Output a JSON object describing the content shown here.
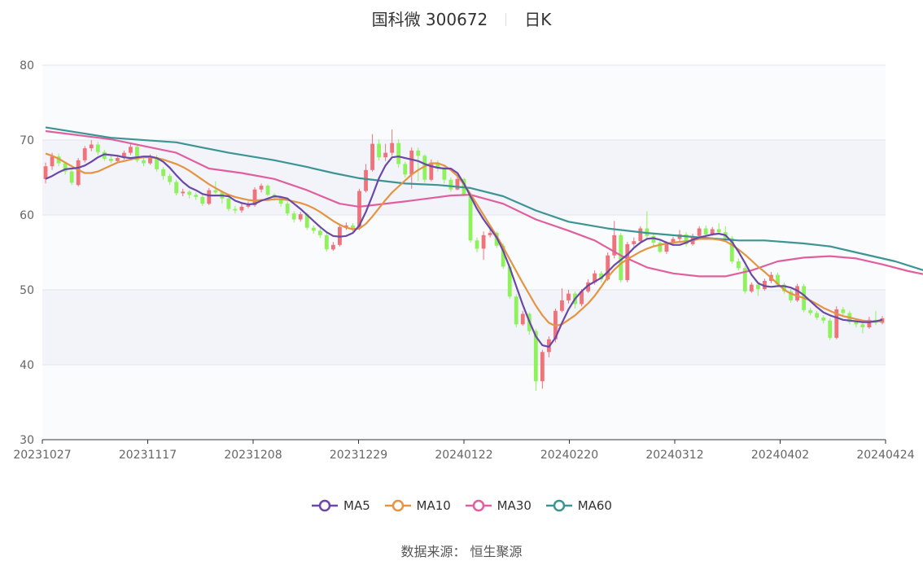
{
  "header": {
    "name_code": "国科微 300672",
    "period": "日K"
  },
  "source": "数据来源：  恒生聚源",
  "colors": {
    "up": "#f0727a",
    "down": "#8ef25a",
    "MA5": "#6a48a8",
    "MA10": "#e59442",
    "MA30": "#e0609f",
    "MA60": "#3d9494"
  },
  "chart_data": {
    "type": "candlestick",
    "title": "国科微 300672",
    "x_ticks": [
      "20231027",
      "20231117",
      "20231208",
      "20231229",
      "20240122",
      "20240220",
      "20240312",
      "20240402",
      "20240424"
    ],
    "y_ticks": [
      30,
      40,
      50,
      60,
      70,
      80
    ],
    "ylim": [
      30,
      80
    ],
    "legend": [
      "MA5",
      "MA10",
      "MA30",
      "MA60"
    ],
    "candles": [
      [
        64.8,
        66.5,
        67.0,
        64.2
      ],
      [
        66.5,
        67.8,
        68.3,
        66.0
      ],
      [
        67.8,
        66.9,
        68.2,
        66.5
      ],
      [
        66.9,
        65.8,
        67.1,
        65.4
      ],
      [
        65.8,
        64.3,
        66.0,
        64.0
      ],
      [
        64.0,
        67.3,
        67.6,
        63.8
      ],
      [
        67.3,
        68.9,
        69.2,
        67.0
      ],
      [
        68.9,
        69.4,
        70.0,
        68.5
      ],
      [
        69.4,
        68.4,
        69.8,
        68.0
      ],
      [
        68.4,
        67.5,
        68.7,
        67.2
      ],
      [
        67.5,
        67.2,
        67.9,
        66.9
      ],
      [
        67.2,
        67.6,
        68.0,
        66.9
      ],
      [
        67.6,
        68.3,
        68.6,
        67.4
      ],
      [
        68.3,
        69.1,
        69.6,
        68.0
      ],
      [
        69.1,
        67.3,
        69.3,
        67.0
      ],
      [
        67.3,
        66.9,
        67.6,
        66.5
      ],
      [
        66.9,
        67.7,
        68.1,
        66.7
      ],
      [
        67.7,
        66.1,
        68.0,
        65.8
      ],
      [
        66.1,
        65.2,
        66.4,
        64.7
      ],
      [
        65.2,
        64.4,
        65.5,
        64.0
      ],
      [
        64.4,
        62.9,
        64.7,
        62.6
      ],
      [
        62.9,
        63.1,
        63.5,
        62.5
      ],
      [
        63.1,
        62.7,
        63.3,
        62.2
      ],
      [
        62.7,
        62.4,
        63.0,
        62.0
      ],
      [
        62.4,
        61.5,
        62.7,
        61.2
      ],
      [
        61.5,
        63.3,
        63.6,
        61.3
      ],
      [
        63.3,
        63.0,
        64.5,
        62.8
      ],
      [
        63.0,
        62.2,
        63.3,
        61.5
      ],
      [
        62.2,
        60.8,
        62.4,
        60.5
      ],
      [
        60.8,
        60.6,
        61.2,
        60.2
      ],
      [
        60.6,
        61.1,
        61.5,
        60.3
      ],
      [
        61.1,
        61.3,
        61.8,
        60.9
      ],
      [
        61.3,
        63.4,
        63.7,
        61.1
      ],
      [
        63.4,
        63.9,
        64.2,
        63.0
      ],
      [
        63.9,
        62.7,
        64.1,
        62.5
      ],
      [
        62.7,
        62.3,
        62.9,
        61.9
      ],
      [
        62.3,
        61.5,
        62.5,
        61.1
      ],
      [
        61.5,
        60.2,
        61.8,
        59.9
      ],
      [
        60.2,
        59.4,
        60.5,
        59.0
      ],
      [
        59.4,
        60.1,
        60.4,
        59.1
      ],
      [
        60.1,
        58.3,
        60.3,
        58.0
      ],
      [
        58.3,
        57.9,
        58.6,
        57.5
      ],
      [
        57.9,
        57.3,
        58.2,
        56.9
      ],
      [
        57.3,
        55.4,
        57.6,
        55.1
      ],
      [
        55.4,
        56.0,
        56.4,
        55.2
      ],
      [
        56.0,
        58.4,
        58.8,
        55.8
      ],
      [
        58.4,
        58.6,
        59.0,
        58.0
      ],
      [
        58.6,
        58.2,
        58.9,
        57.8
      ],
      [
        58.2,
        63.2,
        63.5,
        58.0
      ],
      [
        63.2,
        66.0,
        66.8,
        63.0
      ],
      [
        66.0,
        69.5,
        70.8,
        65.8
      ],
      [
        69.5,
        67.7,
        70.1,
        67.3
      ],
      [
        67.7,
        68.3,
        69.5,
        67.2
      ],
      [
        68.3,
        69.6,
        71.4,
        67.9
      ],
      [
        69.6,
        66.8,
        70.1,
        66.3
      ],
      [
        66.8,
        65.4,
        67.1,
        65.0
      ],
      [
        65.4,
        68.6,
        69.0,
        63.5
      ],
      [
        68.6,
        67.9,
        69.0,
        64.5
      ],
      [
        67.9,
        64.7,
        68.1,
        64.3
      ],
      [
        64.7,
        67.0,
        67.4,
        64.5
      ],
      [
        67.0,
        66.2,
        67.3,
        65.8
      ],
      [
        66.2,
        64.7,
        66.5,
        64.2
      ],
      [
        64.7,
        63.4,
        65.0,
        63.1
      ],
      [
        63.4,
        64.8,
        65.2,
        63.3
      ],
      [
        64.8,
        62.7,
        65.0,
        62.5
      ],
      [
        62.7,
        56.6,
        63.0,
        56.3
      ],
      [
        56.6,
        55.5,
        57.0,
        55.0
      ],
      [
        55.5,
        57.3,
        57.8,
        54.0
      ],
      [
        57.3,
        57.6,
        58.0,
        57.0
      ],
      [
        57.6,
        55.9,
        57.8,
        55.6
      ],
      [
        55.9,
        53.1,
        56.2,
        52.8
      ],
      [
        53.1,
        49.1,
        53.4,
        48.8
      ],
      [
        49.1,
        45.4,
        49.4,
        45.0
      ],
      [
        45.4,
        46.8,
        47.2,
        45.2
      ],
      [
        46.8,
        44.5,
        47.0,
        44.0
      ],
      [
        44.5,
        37.8,
        44.8,
        36.5
      ],
      [
        37.8,
        41.7,
        42.0,
        36.8
      ],
      [
        41.7,
        43.4,
        43.8,
        41.0
      ],
      [
        43.4,
        47.2,
        47.5,
        43.0
      ],
      [
        47.2,
        48.6,
        50.2,
        47.0
      ],
      [
        48.6,
        49.5,
        50.0,
        48.2
      ],
      [
        49.5,
        48.1,
        49.8,
        47.5
      ],
      [
        48.1,
        49.8,
        50.1,
        47.8
      ],
      [
        49.8,
        51.0,
        51.4,
        49.6
      ],
      [
        51.0,
        52.2,
        52.6,
        50.7
      ],
      [
        52.2,
        51.4,
        52.5,
        51.0
      ],
      [
        51.4,
        54.6,
        55.0,
        51.2
      ],
      [
        54.6,
        57.3,
        59.2,
        54.2
      ],
      [
        57.3,
        51.3,
        57.6,
        51.0
      ],
      [
        51.3,
        56.1,
        56.4,
        51.0
      ],
      [
        56.1,
        56.5,
        57.0,
        55.8
      ],
      [
        56.5,
        58.2,
        58.5,
        56.2
      ],
      [
        58.2,
        57.2,
        60.5,
        56.9
      ],
      [
        57.2,
        56.3,
        57.5,
        55.9
      ],
      [
        56.3,
        55.1,
        56.6,
        54.9
      ],
      [
        55.1,
        56.2,
        56.5,
        54.8
      ],
      [
        56.2,
        56.8,
        57.1,
        55.9
      ],
      [
        56.8,
        57.4,
        58.0,
        56.5
      ],
      [
        57.4,
        56.1,
        57.7,
        55.8
      ],
      [
        56.1,
        57.2,
        57.5,
        55.9
      ],
      [
        57.2,
        58.2,
        58.5,
        57.0
      ],
      [
        58.2,
        57.4,
        58.6,
        57.1
      ],
      [
        57.4,
        58.1,
        58.4,
        57.2
      ],
      [
        58.1,
        57.7,
        58.9,
        57.4
      ],
      [
        57.7,
        56.9,
        58.5,
        56.6
      ],
      [
        56.9,
        53.8,
        57.2,
        53.5
      ],
      [
        53.8,
        52.9,
        54.2,
        52.6
      ],
      [
        52.9,
        49.8,
        53.2,
        49.5
      ],
      [
        49.8,
        50.7,
        51.0,
        49.6
      ],
      [
        50.7,
        50.1,
        51.0,
        49.2
      ],
      [
        50.1,
        51.2,
        51.5,
        49.9
      ],
      [
        51.2,
        52.0,
        52.4,
        50.9
      ],
      [
        52.0,
        50.7,
        52.3,
        50.4
      ],
      [
        50.7,
        49.8,
        51.0,
        49.5
      ],
      [
        49.8,
        48.6,
        50.1,
        48.3
      ],
      [
        48.6,
        50.5,
        50.8,
        48.4
      ],
      [
        50.5,
        47.3,
        50.8,
        47.0
      ],
      [
        47.3,
        46.9,
        47.6,
        46.6
      ],
      [
        46.9,
        46.3,
        47.2,
        46.0
      ],
      [
        46.3,
        45.9,
        46.6,
        45.5
      ],
      [
        45.9,
        43.6,
        46.2,
        43.3
      ],
      [
        43.6,
        47.4,
        47.8,
        43.4
      ],
      [
        47.4,
        46.9,
        47.7,
        46.6
      ],
      [
        46.9,
        45.7,
        47.2,
        45.4
      ],
      [
        45.7,
        45.4,
        46.0,
        45.0
      ],
      [
        45.4,
        45.0,
        45.7,
        44.2
      ],
      [
        45.0,
        46.0,
        46.4,
        44.8
      ],
      [
        46.0,
        45.6,
        47.2,
        45.3
      ],
      [
        45.6,
        46.2,
        46.5,
        45.4
      ]
    ],
    "ma_series": {
      "MA5": [
        64.8,
        65.2,
        65.7,
        66.1,
        66.2,
        66.3,
        66.6,
        67.1,
        67.7,
        68.1,
        68.0,
        67.9,
        67.7,
        67.6,
        67.7,
        67.8,
        67.8,
        67.6,
        67.1,
        66.3,
        65.3,
        64.4,
        63.7,
        63.3,
        62.8,
        62.6,
        62.6,
        62.6,
        62.5,
        61.9,
        61.6,
        61.4,
        61.5,
        61.9,
        62.2,
        62.5,
        62.4,
        62.2,
        61.5,
        60.8,
        60.0,
        59.2,
        58.4,
        57.7,
        57.2,
        57.1,
        57.2,
        57.6,
        58.6,
        60.4,
        62.6,
        64.9,
        66.6,
        67.7,
        67.8,
        67.6,
        67.4,
        67.2,
        66.8,
        66.5,
        66.3,
        66.2,
        66.2,
        65.6,
        64.2,
        62.5,
        60.8,
        59.4,
        58.2,
        57.0,
        55.2,
        53.0,
        50.5,
        48.0,
        45.8,
        43.8,
        42.6,
        42.4,
        43.6,
        45.6,
        47.4,
        48.8,
        49.8,
        50.6,
        51.1,
        51.6,
        52.4,
        53.3,
        54.0,
        54.7,
        55.6,
        56.3,
        56.8,
        56.9,
        56.7,
        56.3,
        56.0,
        56.0,
        56.3,
        56.7,
        57.0,
        57.2,
        57.4,
        57.5,
        57.3,
        56.4,
        55.1,
        53.6,
        52.0,
        50.9,
        50.5,
        50.4,
        50.5,
        50.5,
        50.3,
        49.9,
        49.3,
        48.5,
        47.7,
        47.0,
        46.6,
        46.3,
        46.0,
        45.9,
        45.8,
        45.7,
        45.7,
        45.8,
        46.0
      ],
      "MA10": [
        68.2,
        67.9,
        67.5,
        67.0,
        66.5,
        66.0,
        65.6,
        65.6,
        65.8,
        66.2,
        66.6,
        67.0,
        67.2,
        67.4,
        67.6,
        67.7,
        67.7,
        67.6,
        67.4,
        67.1,
        66.8,
        66.4,
        65.9,
        65.3,
        64.7,
        64.1,
        63.6,
        63.1,
        62.7,
        62.4,
        62.2,
        62.0,
        61.9,
        62.0,
        62.0,
        62.1,
        62.1,
        62.0,
        61.8,
        61.6,
        61.3,
        60.9,
        60.4,
        59.8,
        59.2,
        58.7,
        58.3,
        58.1,
        58.2,
        58.8,
        59.8,
        60.9,
        62.0,
        63.0,
        63.8,
        64.6,
        65.4,
        66.0,
        66.5,
        66.9,
        66.9,
        66.6,
        66.0,
        65.2,
        64.1,
        62.8,
        61.4,
        60.0,
        58.6,
        57.2,
        55.7,
        54.1,
        52.5,
        50.9,
        49.4,
        47.9,
        46.6,
        45.6,
        45.2,
        45.4,
        46.0,
        46.6,
        47.4,
        48.2,
        49.2,
        50.4,
        51.7,
        52.7,
        53.5,
        54.1,
        54.6,
        55.1,
        55.5,
        55.8,
        56.0,
        56.2,
        56.3,
        56.4,
        56.5,
        56.6,
        56.8,
        56.8,
        56.8,
        56.7,
        56.5,
        56.0,
        55.4,
        54.7,
        53.9,
        53.1,
        52.4,
        51.6,
        50.8,
        50.0,
        49.5,
        49.2,
        48.9,
        48.6,
        48.1,
        47.6,
        47.2,
        46.8,
        46.5,
        46.3,
        46.1,
        45.9,
        45.8,
        45.8,
        45.8
      ]
    },
    "ma_lines": {
      "MA30": [
        [
          0,
          71.2
        ],
        [
          10,
          70.1
        ],
        [
          20,
          68.3
        ],
        [
          25,
          66.2
        ],
        [
          30,
          65.6
        ],
        [
          35,
          64.8
        ],
        [
          40,
          63.3
        ],
        [
          45,
          61.5
        ],
        [
          48,
          61.1
        ],
        [
          55,
          61.8
        ],
        [
          62,
          62.6
        ],
        [
          65,
          62.7
        ],
        [
          70,
          61.5
        ],
        [
          75,
          59.4
        ],
        [
          80,
          57.9
        ],
        [
          84,
          56.6
        ],
        [
          88,
          54.6
        ],
        [
          92,
          53.0
        ],
        [
          96,
          52.2
        ],
        [
          100,
          51.8
        ],
        [
          104,
          51.8
        ],
        [
          108,
          52.6
        ],
        [
          112,
          53.8
        ],
        [
          116,
          54.3
        ],
        [
          120,
          54.5
        ],
        [
          124,
          54.2
        ],
        [
          128,
          53.4
        ],
        [
          132,
          52.5
        ],
        [
          136,
          51.8
        ],
        [
          140,
          51.0
        ]
      ],
      "MA60": [
        [
          0,
          71.7
        ],
        [
          10,
          70.3
        ],
        [
          20,
          69.7
        ],
        [
          28,
          68.3
        ],
        [
          35,
          67.3
        ],
        [
          40,
          66.4
        ],
        [
          44,
          65.6
        ],
        [
          48,
          64.9
        ],
        [
          55,
          64.2
        ],
        [
          60,
          64.0
        ],
        [
          65,
          63.6
        ],
        [
          70,
          62.5
        ],
        [
          75,
          60.6
        ],
        [
          80,
          59.1
        ],
        [
          86,
          58.2
        ],
        [
          92,
          57.6
        ],
        [
          100,
          57.0
        ],
        [
          106,
          56.6
        ],
        [
          110,
          56.6
        ],
        [
          116,
          56.2
        ],
        [
          120,
          55.8
        ],
        [
          124,
          55.0
        ],
        [
          130,
          53.8
        ],
        [
          134,
          52.7
        ],
        [
          140,
          51.3
        ]
      ]
    }
  }
}
